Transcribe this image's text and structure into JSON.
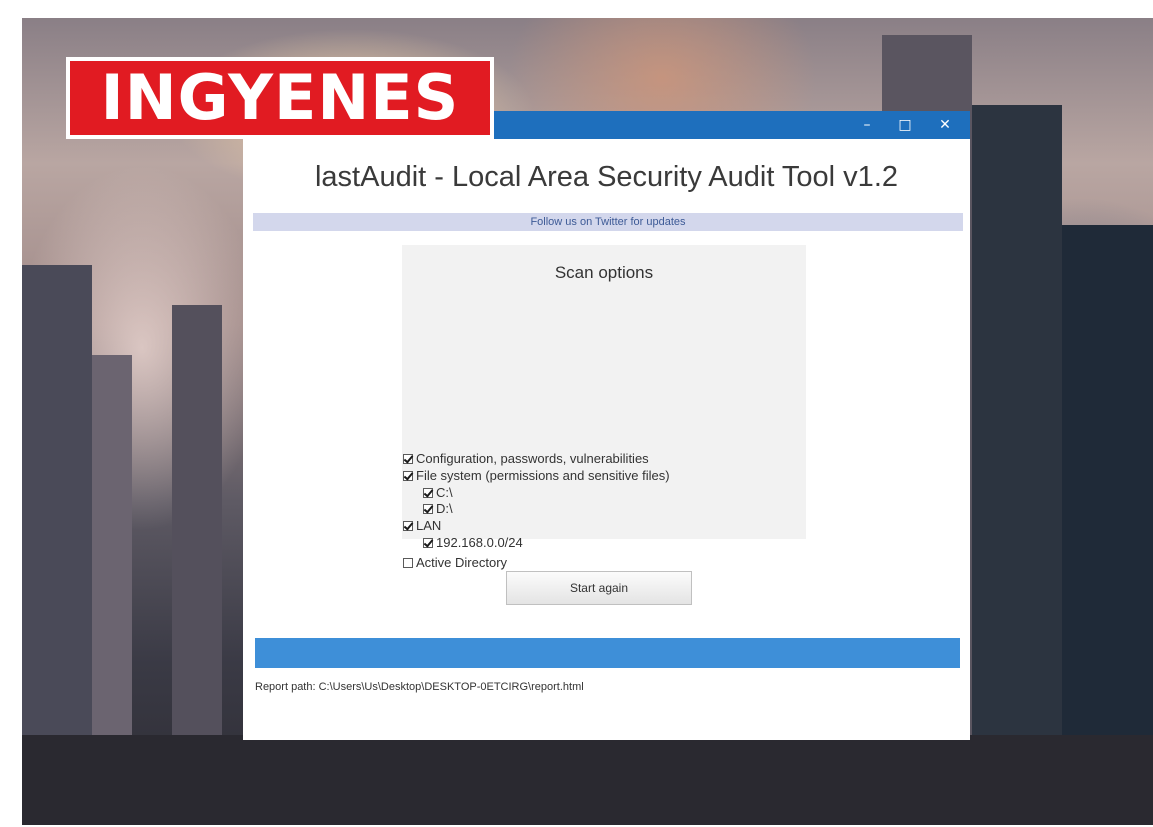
{
  "banner": {
    "text": "INGYENES"
  },
  "window": {
    "controls": {
      "minimize": "–",
      "maximize": "□",
      "close": "✕"
    },
    "app_title": "lastAudit - Local Area Security Audit Tool v1.2",
    "twitter_link": "Follow us on Twitter for updates",
    "scan_options": {
      "title": "Scan options",
      "options": [
        {
          "label": "Configuration, passwords, vulnerabilities",
          "checked": true
        },
        {
          "label": "File system (permissions and sensitive files)",
          "checked": true
        },
        {
          "label": "C:\\",
          "checked": true
        },
        {
          "label": "D:\\",
          "checked": true
        },
        {
          "label": "LAN",
          "checked": true
        },
        {
          "label": "192.168.0.0/24",
          "checked": true
        },
        {
          "label": "Active Directory",
          "checked": false
        }
      ]
    },
    "start_button": "Start again",
    "progress": 1.0,
    "report_path": "Report path: C:\\Users\\Us\\Desktop\\DESKTOP-0ETCIRG\\report.html"
  },
  "colors": {
    "banner_red": "#e11b22",
    "titlebar_blue": "#1e6fbd",
    "progress_blue": "#3e8fd8",
    "twitter_bar_bg": "#d3d7ec"
  }
}
